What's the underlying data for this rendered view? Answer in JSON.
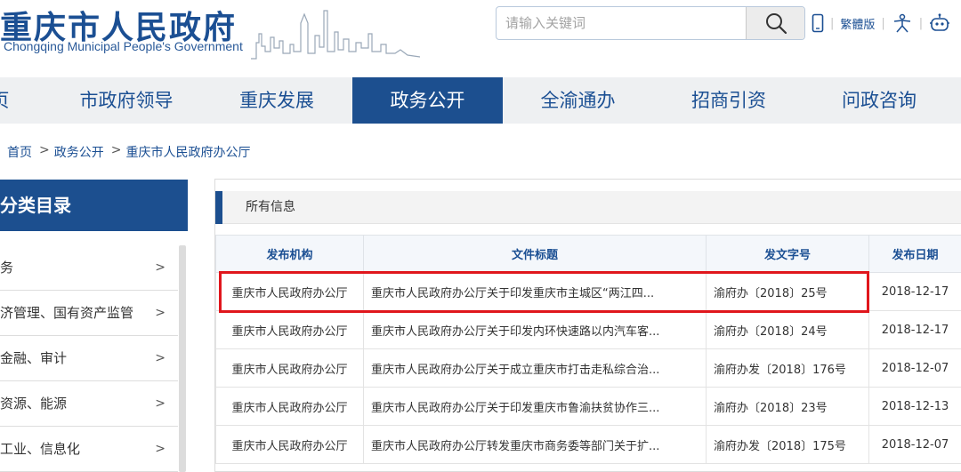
{
  "header": {
    "title": "重庆市人民政府",
    "subtitle": "Chongqing Municipal People's Government",
    "search_placeholder": "请输入关键词",
    "traditional_label": "繁體版"
  },
  "nav": {
    "items": [
      {
        "label": "页"
      },
      {
        "label": "市政府领导"
      },
      {
        "label": "重庆发展"
      },
      {
        "label": "政务公开"
      },
      {
        "label": "全渝通办"
      },
      {
        "label": "招商引资"
      },
      {
        "label": "问政咨询"
      }
    ],
    "active_index": 3
  },
  "breadcrumb": [
    "首页",
    "政务公开",
    "重庆市人民政府办公厅"
  ],
  "sidebar": {
    "heading": "分类目录",
    "items": [
      {
        "label": "务",
        "arrow": ">"
      },
      {
        "label": "济管理、国有资产监管",
        "arrow": ">"
      },
      {
        "label": "金融、审计",
        "arrow": ">"
      },
      {
        "label": "资源、能源",
        "arrow": ">"
      },
      {
        "label": "工业、信息化",
        "arrow": ">"
      }
    ]
  },
  "panel": {
    "title": "所有信息",
    "columns": [
      "发布机构",
      "文件标题",
      "发文字号",
      "发布日期"
    ],
    "rows": [
      {
        "agency": "重庆市人民政府办公厅",
        "title": "重庆市人民政府办公厅关于印发重庆市主城区“两江四...",
        "docno": "渝府办〔2018〕25号",
        "date": "2018-12-17"
      },
      {
        "agency": "重庆市人民政府办公厅",
        "title": "重庆市人民政府办公厅关于印发内环快速路以内汽车客...",
        "docno": "渝府办〔2018〕24号",
        "date": "2018-12-17"
      },
      {
        "agency": "重庆市人民政府办公厅",
        "title": "重庆市人民政府办公厅关于成立重庆市打击走私综合治...",
        "docno": "渝府办发〔2018〕176号",
        "date": "2018-12-07"
      },
      {
        "agency": "重庆市人民政府办公厅",
        "title": "重庆市人民政府办公厅关于印发重庆市鲁渝扶贫协作三...",
        "docno": "渝府办〔2018〕23号",
        "date": "2018-12-13"
      },
      {
        "agency": "重庆市人民政府办公厅",
        "title": "重庆市人民政府办公厅转发重庆市商务委等部门关于扩...",
        "docno": "渝府办发〔2018〕175号",
        "date": "2018-12-07"
      }
    ],
    "highlighted_row_index": 0
  },
  "colors": {
    "brand_blue": "#1c4f8f",
    "highlight_red": "#e0161c"
  },
  "icons": [
    "search-icon",
    "mobile-icon",
    "accessibility-icon",
    "robot-icon"
  ]
}
